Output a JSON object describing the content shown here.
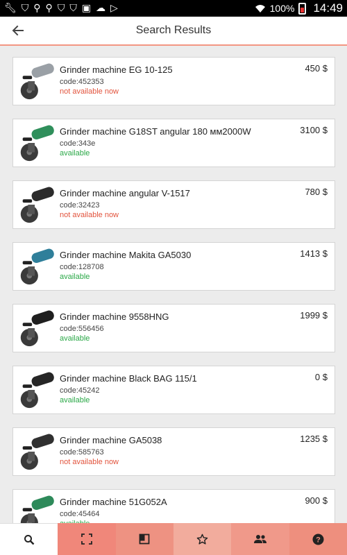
{
  "status_bar": {
    "icons": [
      "wrench-icon",
      "shield-icon",
      "keyhole-icon",
      "keyhole-icon",
      "shield-icon",
      "shield-icon",
      "image-icon",
      "cloud-upload-icon",
      "play-store-icon"
    ],
    "battery_percent": "100%",
    "time": "14:49"
  },
  "appbar": {
    "title": "Search Results"
  },
  "results": [
    {
      "name": "Grinder machine EG 10-125",
      "code": "code:452353",
      "status": "not available now",
      "available": false,
      "price": "450 $",
      "image_color": "#9aa0a6"
    },
    {
      "name": "Grinder machine G18ST angular 180 мм2000W",
      "code": "code:343e",
      "status": "available",
      "available": true,
      "price": "3100 $",
      "image_color": "#2f8f5b"
    },
    {
      "name": "Grinder machine angular V-1517",
      "code": "code:32423",
      "status": "not available now",
      "available": false,
      "price": "780 $",
      "image_color": "#2b2b2b"
    },
    {
      "name": "Grinder machine Makita GA5030",
      "code": "code:128708",
      "status": "available",
      "available": true,
      "price": "1413 $",
      "image_color": "#2f7f9a"
    },
    {
      "name": "Grinder machine 9558HNG",
      "code": "code:556456",
      "status": "available",
      "available": true,
      "price": "1999 $",
      "image_color": "#1f1f1f"
    },
    {
      "name": "Grinder machine Black BAG 115/1",
      "code": "code:45242",
      "status": "available",
      "available": true,
      "price": "0 $",
      "image_color": "#262626"
    },
    {
      "name": "Grinder machine GA5038",
      "code": "code:585763",
      "status": "not available now",
      "available": false,
      "price": "1235 $",
      "image_color": "#303030"
    },
    {
      "name": "Grinder machine 51G052A",
      "code": "code:45464",
      "status": "available",
      "available": true,
      "price": "900 $",
      "image_color": "#2e8a5a"
    }
  ],
  "bottom_nav": [
    {
      "icon": "search-icon",
      "active": true
    },
    {
      "icon": "scan-icon",
      "active": false
    },
    {
      "icon": "catalog-icon",
      "active": false
    },
    {
      "icon": "star-icon",
      "active": false
    },
    {
      "icon": "people-icon",
      "active": false
    },
    {
      "icon": "help-icon",
      "active": false
    }
  ]
}
